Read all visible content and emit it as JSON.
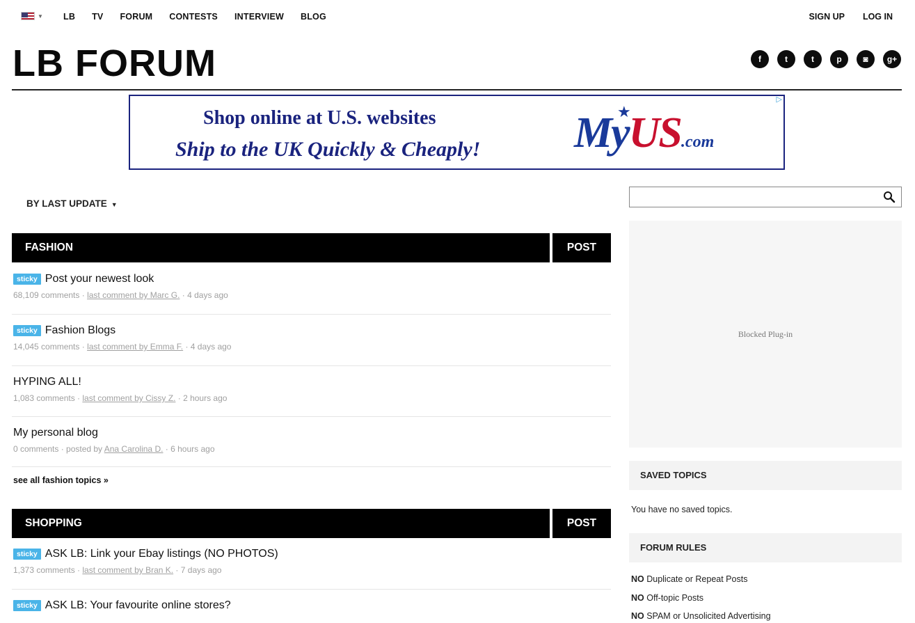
{
  "nav": {
    "flag_icon": "us-flag-icon",
    "links": [
      "LB",
      "TV",
      "FORUM",
      "CONTESTS",
      "INTERVIEW",
      "BLOG"
    ],
    "sign_up": "SIGN UP",
    "log_in": "LOG IN"
  },
  "header": {
    "title": "LB FORUM",
    "social": [
      "f",
      "t",
      "t",
      "p",
      "◙",
      "g+"
    ]
  },
  "ad": {
    "line1": "Shop online at U.S. websites",
    "line2": "Ship to the UK Quickly & Cheaply!",
    "logo_my": "My",
    "logo_us": "US",
    "logo_com": ".com"
  },
  "sort": {
    "label": "BY LAST UPDATE"
  },
  "sections": {
    "fashion": {
      "title": "FASHION",
      "post": "POST",
      "topics": [
        {
          "sticky": "sticky",
          "title": "Post your newest look",
          "meta_pre": "68,109 comments · ",
          "author": "last comment by Marc G.",
          "meta_post": " · 4 days ago"
        },
        {
          "sticky": "sticky",
          "title": "Fashion Blogs",
          "meta_pre": "14,045 comments · ",
          "author": "last comment by Emma F.",
          "meta_post": " · 4 days ago"
        },
        {
          "title": "HYPING ALL!",
          "meta_pre": "1,083 comments · ",
          "author": "last comment by Cissy Z.",
          "meta_post": " · 2 hours ago"
        },
        {
          "title": "My personal blog",
          "meta_pre": "0 comments · posted by ",
          "author": "Ana Carolina D.",
          "meta_post": " · 6 hours ago"
        }
      ],
      "see_all": "see all fashion topics »"
    },
    "shopping": {
      "title": "SHOPPING",
      "post": "POST",
      "topics": [
        {
          "sticky": "sticky",
          "title": "ASK LB: Link your Ebay listings (NO PHOTOS)",
          "meta_pre": "1,373 comments · ",
          "author": "last comment by Bran K.",
          "meta_post": " · 7 days ago"
        },
        {
          "sticky": "sticky",
          "title": "ASK LB: Your favourite online stores?"
        }
      ]
    }
  },
  "sidebar": {
    "search_placeholder": "",
    "plugin_text": "Blocked Plug-in",
    "saved_topics_title": "SAVED TOPICS",
    "saved_topics_text": "You have no saved topics.",
    "forum_rules_title": "FORUM RULES",
    "rules": [
      {
        "no": "NO",
        "text": " Duplicate or Repeat Posts"
      },
      {
        "no": "NO",
        "text": " Off-topic Posts"
      },
      {
        "no": "NO",
        "text": " SPAM or Unsolicited Advertising"
      }
    ]
  }
}
